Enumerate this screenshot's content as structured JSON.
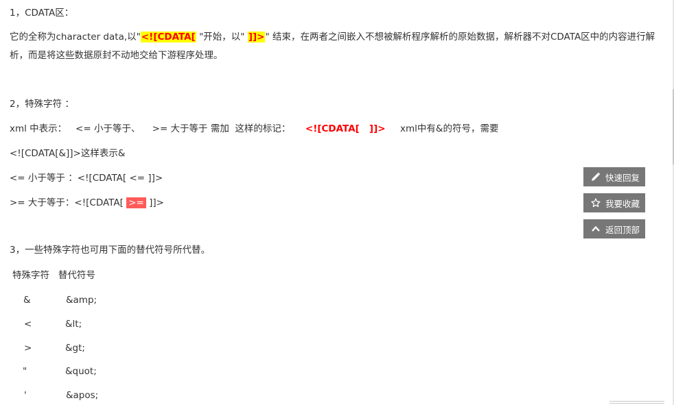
{
  "section1": {
    "heading": "1，CDATA区：",
    "desc_pre": "它的全称为character data,以\"",
    "desc_start_tag": "<![CDATA[",
    "desc_mid": " \"开始，以\" ",
    "desc_end_tag": "]]>",
    "desc_post": "\" 结束，在两者之间嵌入不想被解析程序解析的原始数据，解析器不对CDATA区中的内容进行解析，而是将这些数据原封不动地交给下游程序处理。"
  },
  "section2": {
    "heading": "2，特殊字符 ：",
    "line1_pre": "xml 中表示：   <= 小于等于、    >= 大于等于 需加  这样的标记：     ",
    "line1_tag": "<![CDATA[   ]]>",
    "line1_post": "     xml中有&的符号，需要",
    "line2": "<![CDATA[&]]>这样表示&",
    "line3": "<= 小于等于 ：<![CDATA[ <= ]]>",
    "line4_pre": ">= 大于等于：<![CDATA[ ",
    "line4_hl": ">=",
    "line4_post": " ]]>"
  },
  "section3": {
    "heading": "3，一些特殊字符也可用下面的替代符号所代替。",
    "table_header": "特殊字符   替代符号",
    "rows": [
      {
        "char": "&",
        "entity": "&amp;"
      },
      {
        "char": "<",
        "entity": "&lt;"
      },
      {
        "char": ">",
        "entity": "&gt;"
      },
      {
        "char": "\"",
        "entity": "&quot;"
      },
      {
        "char": "'",
        "entity": "&apos;"
      }
    ]
  },
  "float_buttons": {
    "quick_reply": {
      "label": "快速回复",
      "icon": "pencil-icon"
    },
    "favorite": {
      "label": "我要收藏",
      "icon": "star-icon"
    },
    "back_to_top": {
      "label": "返回顶部",
      "icon": "chevron-up-icon"
    }
  },
  "colors": {
    "highlight_yellow": "#ffff00",
    "highlight_red_text": "#ff0000",
    "highlight_red_box": "#ff5a5a",
    "float_button_bg": "#777777"
  }
}
